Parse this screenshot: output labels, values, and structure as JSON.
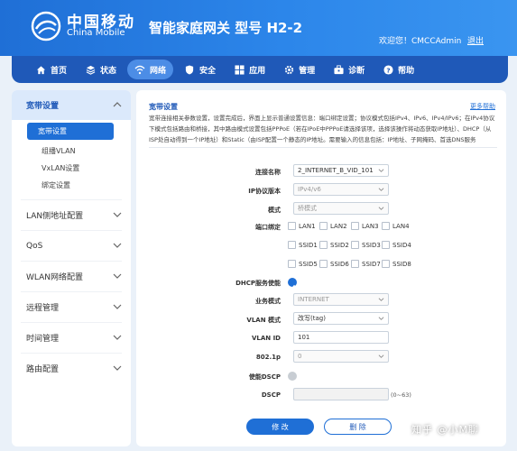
{
  "brand": {
    "name_cn": "中国移动",
    "name_en": "China Mobile"
  },
  "product_title": "智能家庭网关  型号 H2-2",
  "user": {
    "welcome": "欢迎您！CMCCAdmin",
    "logout": "退出"
  },
  "nav": [
    {
      "label": "首页",
      "icon": "home-icon"
    },
    {
      "label": "状态",
      "icon": "layers-icon"
    },
    {
      "label": "网络",
      "icon": "wifi-icon",
      "active": true
    },
    {
      "label": "安全",
      "icon": "shield-icon"
    },
    {
      "label": "应用",
      "icon": "apps-icon"
    },
    {
      "label": "管理",
      "icon": "gear-icon"
    },
    {
      "label": "诊断",
      "icon": "toolbox-icon"
    },
    {
      "label": "帮助",
      "icon": "help-icon"
    }
  ],
  "sidebar": {
    "groups": [
      {
        "label": "宽带设置",
        "open": true,
        "items": [
          "宽带设置",
          "组播VLAN",
          "VxLAN设置",
          "绑定设置"
        ]
      },
      {
        "label": "LAN侧地址配置"
      },
      {
        "label": "QoS"
      },
      {
        "label": "WLAN网络配置"
      },
      {
        "label": "远程管理"
      },
      {
        "label": "时间管理"
      },
      {
        "label": "路由配置"
      }
    ]
  },
  "main": {
    "title": "宽带设置",
    "more_help": "更多帮助",
    "description": "宽带连接相关参数设置，设置完成后，界面上显示普通设置信息：端口绑定设置；协议模式包括IPv4、IPv6、IPv4/IPv6；在IPv4协议下模式包括路由和桥接，其中路由模式设置包括PPPoE（若在IPoE中PPPoE请选择该项，选择该操作将动态获取IP地址）、DHCP（从ISP处自动得到一个IP地址）和Static（由ISP配置一个静态的IP地址。需要输入的信息包括：IP地址、子网掩码、首选DNS服务"
  },
  "form": {
    "connection_name": {
      "label": "连接名称",
      "value": "2_INTERNET_B_VID_101"
    },
    "ip_protocol": {
      "label": "IP协议版本",
      "value": "IPv4/v6"
    },
    "mode": {
      "label": "模式",
      "value": "桥模式"
    },
    "port_binding": {
      "label": "端口绑定",
      "lan": [
        "LAN1",
        "LAN2",
        "LAN3",
        "LAN4"
      ],
      "ssid_row1": [
        "SSID1",
        "SSID2",
        "SSID3",
        "SSID4"
      ],
      "ssid_row2": [
        "SSID5",
        "SSID6",
        "SSID7",
        "SSID8"
      ]
    },
    "dhcp_passthrough": {
      "label": "DHCP服务使能"
    },
    "service_mode": {
      "label": "业务模式",
      "value": "INTERNET"
    },
    "vlan_mode": {
      "label": "VLAN 模式",
      "value": "改写(tag)"
    },
    "vlan_id": {
      "label": "VLAN ID",
      "value": "101"
    },
    "dot1p": {
      "label": "802.1p",
      "value": "0"
    },
    "enable_dscp": {
      "label": "使能DSCP"
    },
    "dscp": {
      "label": "DSCP",
      "value": "",
      "hint": "(0~63)"
    }
  },
  "buttons": {
    "modify": "修 改",
    "delete": "删 除"
  },
  "watermark": "知乎 @小M聊",
  "colors": {
    "primary": "#1f6fd6",
    "nav_bg": "#1f59b8",
    "page_bg": "#eaf1f9"
  }
}
